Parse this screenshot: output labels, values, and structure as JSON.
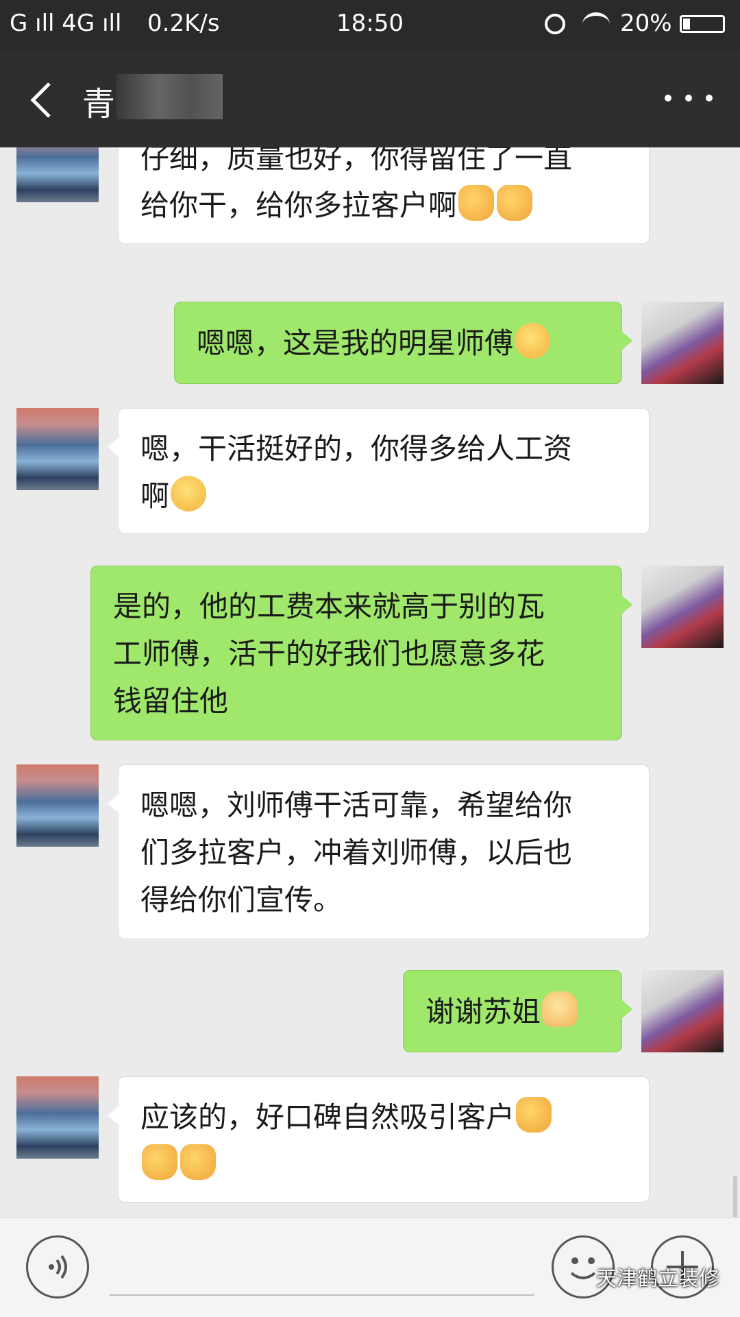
{
  "status_bar": {
    "signal": "G ıll 4G ıll",
    "speed": "0.2K/s",
    "time": "18:50",
    "battery": "20%"
  },
  "header": {
    "title": "青",
    "back_icon": "chevron-left-icon",
    "more_icon": "more-dots-icon"
  },
  "messages": [
    {
      "side": "in",
      "text": "仔细，质量也好，你得留住了一直",
      "text2": "给你干，给你多拉客户啊"
    },
    {
      "side": "out",
      "text": "嗯嗯，这是我的明星师傅"
    },
    {
      "side": "in",
      "text": "嗯，干活挺好的，你得多给人工资",
      "text2": "啊"
    },
    {
      "side": "out",
      "text": "是的，他的工费本来就高于别的瓦",
      "text2": "工师傅，活干的好我们也愿意多花",
      "text3": "钱留住他"
    },
    {
      "side": "in",
      "text": "嗯嗯，刘师傅干活可靠，希望给你",
      "text2": "们多拉客户，冲着刘师傅，以后也",
      "text3": "得给你们宣传。"
    },
    {
      "side": "out",
      "text": "谢谢苏姐"
    },
    {
      "side": "in",
      "text": "应该的，好口碑自然吸引客户"
    }
  ],
  "input_bar": {
    "voice_icon": "voice-icon",
    "emoji_icon": "emoji-icon",
    "plus_icon": "plus-icon"
  },
  "watermark": "天津鹤立装修",
  "colors": {
    "outgoing_bubble": "#9fe86b",
    "incoming_bubble": "#ffffff",
    "header_bg": "#2e2e2e",
    "chat_bg": "#ebebeb"
  }
}
